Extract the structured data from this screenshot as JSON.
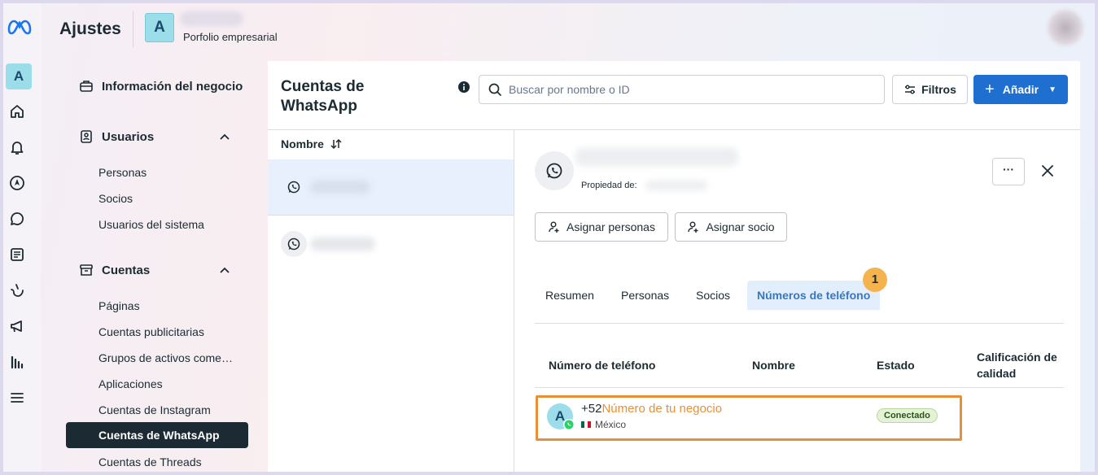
{
  "header": {
    "title": "Ajustes",
    "portfolio_initial": "A",
    "portfolio_label": "Porfolio empresarial"
  },
  "rail": {
    "account_initial": "A",
    "icons": [
      "meta-logo-icon",
      "home-icon",
      "bell-icon",
      "compass-icon",
      "chat-icon",
      "pages-icon",
      "brush-icon",
      "megaphone-icon",
      "bar-chart-icon",
      "menu-icon"
    ]
  },
  "nav": {
    "business_info": "Información del negocio",
    "users_section": "Usuarios",
    "users_items": [
      "Personas",
      "Socios",
      "Usuarios del sistema"
    ],
    "accounts_section": "Cuentas",
    "accounts_items": [
      "Páginas",
      "Cuentas publicitarias",
      "Grupos de activos come…",
      "Aplicaciones",
      "Cuentas de Instagram",
      "Cuentas de WhatsApp",
      "Cuentas de Threads"
    ],
    "active_item": "Cuentas de WhatsApp"
  },
  "main": {
    "title": "Cuentas de WhatsApp",
    "search_placeholder": "Buscar por nombre o ID",
    "filters_label": "Filtros",
    "add_label": "Añadir",
    "list_header": "Nombre"
  },
  "detail": {
    "owned_by_label": "Propiedad de:",
    "more_label": "···",
    "assign_people": "Asignar personas",
    "assign_partner": "Asignar socio",
    "tabs": [
      "Resumen",
      "Personas",
      "Socios",
      "Números de teléfono"
    ],
    "active_tab": "Números de teléfono",
    "step_badge": "1",
    "table_headers": {
      "phone": "Número de teléfono",
      "name": "Nombre",
      "status": "Estado",
      "quality": "Calificación de calidad"
    },
    "phone_row": {
      "avatar_initial": "A",
      "prefix": "+52",
      "business_number": "Número de tu negocio",
      "country": "México",
      "status": "Conectado"
    }
  },
  "colors": {
    "primary_button": "#1f6fd1",
    "highlight_orange": "#e69137",
    "badge_yellow": "#f5b34d",
    "active_nav": "#1c2b33",
    "active_tab_bg": "#e3eefc",
    "status_green_bg": "#e4f3d8"
  }
}
